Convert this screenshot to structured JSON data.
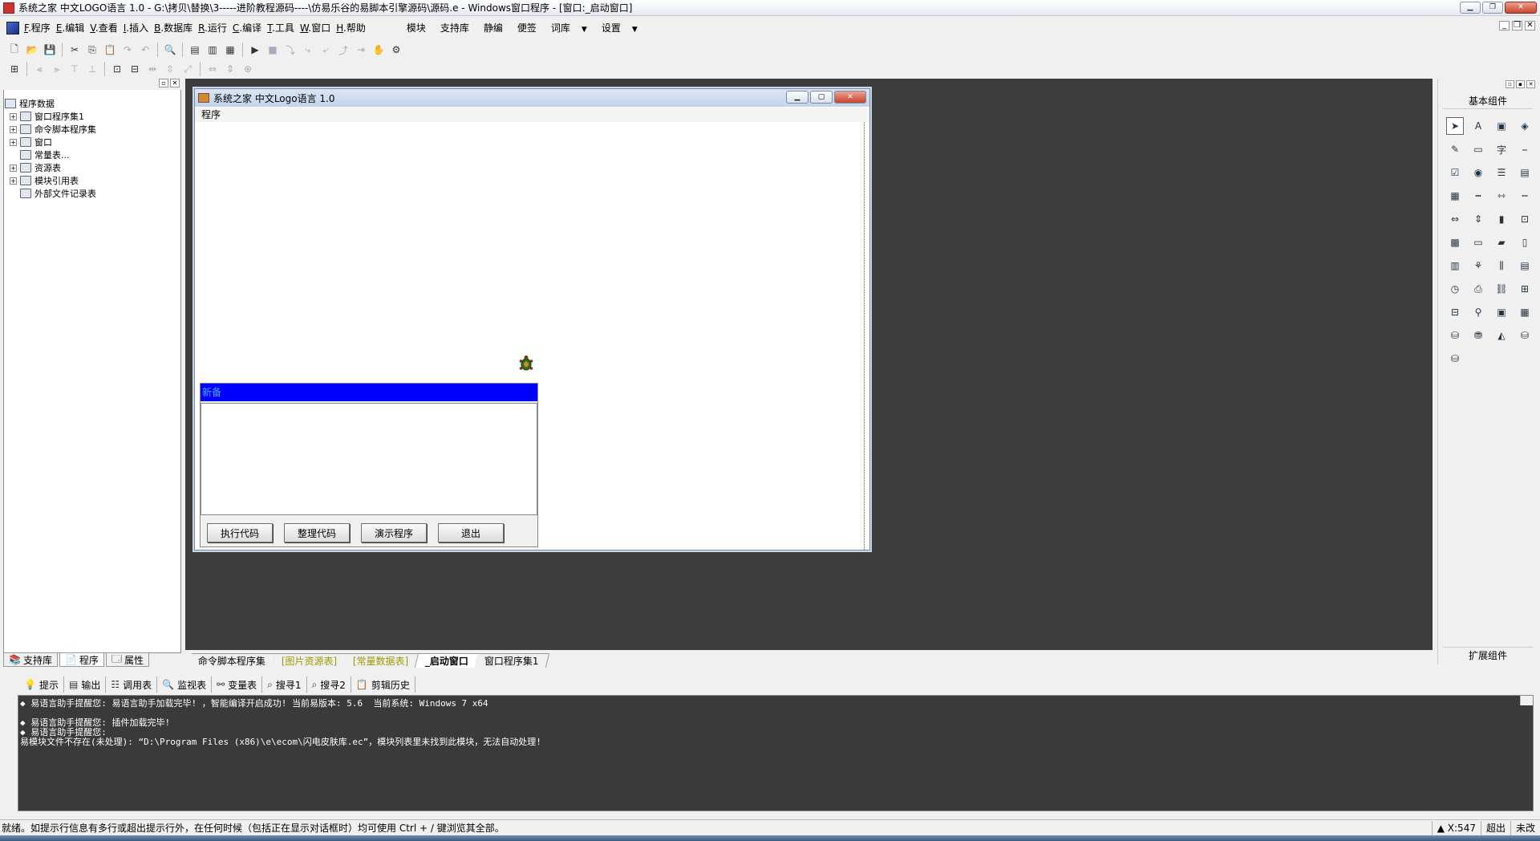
{
  "window": {
    "title": "系统之家 中文LOGO语言 1.0 - G:\\拷贝\\替换\\3-----进阶教程源码----\\仿易乐谷的易脚本引擎源码\\源码.e - Windows窗口程序 - [窗口:_启动窗口]"
  },
  "menu": {
    "items": [
      {
        "key": "F",
        "label": ".程序"
      },
      {
        "key": "E",
        "label": ".编辑"
      },
      {
        "key": "V",
        "label": ".查看"
      },
      {
        "key": "I",
        "label": ".插入"
      },
      {
        "key": "B",
        "label": ".数据库"
      },
      {
        "key": "R",
        "label": ".运行"
      },
      {
        "key": "C",
        "label": ".编译"
      },
      {
        "key": "T",
        "label": ".工具"
      },
      {
        "key": "W",
        "label": ".窗口"
      },
      {
        "key": "H",
        "label": ".帮助"
      }
    ],
    "extra": [
      "模块",
      "支持库",
      "静编",
      "便签",
      "词库",
      "设置"
    ]
  },
  "left_panel": {
    "tree": [
      {
        "label": "程序数据",
        "expand": "none",
        "level": 0
      },
      {
        "label": "窗口程序集1",
        "expand": "+",
        "level": 1
      },
      {
        "label": "命令脚本程序集",
        "expand": "+",
        "level": 1
      },
      {
        "label": "窗口",
        "expand": "+",
        "level": 1
      },
      {
        "label": "常量表...",
        "expand": "none",
        "level": 1
      },
      {
        "label": "资源表",
        "expand": "+",
        "level": 1
      },
      {
        "label": "模块引用表",
        "expand": "+",
        "level": 1
      },
      {
        "label": "外部文件记录表",
        "expand": "none",
        "level": 1
      }
    ],
    "tabs": [
      "支持库",
      "程序",
      "属性"
    ]
  },
  "child_window": {
    "title": "系统之家 中文Logo语言 1.0",
    "menu": "程序",
    "list_header": "新备",
    "buttons": [
      "执行代码",
      "整理代码",
      "演示程序",
      "退出"
    ]
  },
  "doc_tabs": [
    {
      "label": "命令脚本程序集",
      "style": "normal"
    },
    {
      "label": "[图片资源表]",
      "style": "olive"
    },
    {
      "label": "[常量数据表]",
      "style": "olive"
    },
    {
      "label": "_启动窗口",
      "style": "active"
    },
    {
      "label": "窗口程序集1",
      "style": "normal"
    }
  ],
  "right_panel": {
    "title": "基本组件",
    "footer": "扩展组件",
    "palette": [
      "pointer-icon",
      "label-icon",
      "picture-icon",
      "shape-icon",
      "edit-icon",
      "frame-icon",
      "font-icon",
      "line-icon",
      "checkbox-icon",
      "radio-icon",
      "listbox-icon",
      "combobox-icon",
      "grid-icon",
      "ruler-icon",
      "slider-icon",
      "scrollbar-icon",
      "hscroll-icon",
      "vscroll-icon",
      "progress-icon",
      "tabs-icon",
      "calendar-icon",
      "textbox-icon",
      "folder-icon",
      "document-icon",
      "toolbar-icon",
      "tree-icon",
      "split-icon",
      "image-list-icon",
      "timer-icon",
      "printer-icon",
      "network-icon",
      "client-icon",
      "server-icon",
      "port-icon",
      "panel-icon",
      "table-icon",
      "data-source-icon",
      "db-icon",
      "chart-icon",
      "odbc-icon",
      "odbc2-icon"
    ]
  },
  "bottom_tabs": [
    "提示",
    "输出",
    "调用表",
    "监视表",
    "变量表",
    "搜寻1",
    "搜寻2",
    "剪辑历史"
  ],
  "output_lines": [
    "◆ 易语言助手提醒您: 易语言助手加载完毕! ，智能编译开启成功! 当前易版本: 5.6  当前系统: Windows 7 x64",
    "",
    "◆ 易语言助手提醒您: 插件加载完毕!",
    "◆ 易语言助手提醒您:",
    "易模块文件不存在(未处理): “D:\\Program Files (x86)\\e\\ecom\\闪电皮肤库.ec”，模块列表里未找到此模块，无法自动处理!"
  ],
  "status": {
    "message": "就绪。如提示行信息有多行或超出提示行外，在任何时候（包括正在显示对话框时）均可使用 Ctrl + / 键浏览其全部。",
    "coord": "X:547",
    "mode": "超出",
    "state": "未改"
  }
}
